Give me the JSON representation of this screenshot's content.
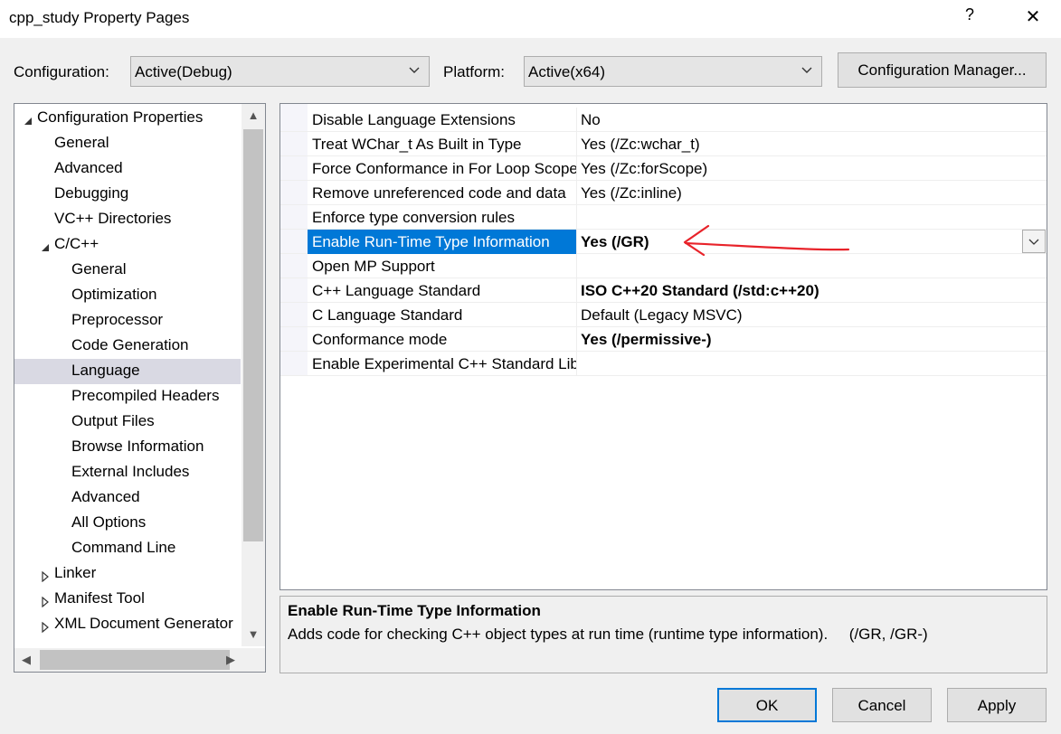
{
  "window": {
    "title": "cpp_study Property Pages",
    "help": "?",
    "close": "✕"
  },
  "config": {
    "config_label": "Configuration:",
    "config_value": "Active(Debug)",
    "platform_label": "Platform:",
    "platform_value": "Active(x64)",
    "manager_button": "Configuration Manager..."
  },
  "tree": {
    "items": [
      {
        "label": "Configuration Properties",
        "expander": "expanded"
      },
      {
        "label": "General"
      },
      {
        "label": "Advanced"
      },
      {
        "label": "Debugging"
      },
      {
        "label": "VC++ Directories"
      },
      {
        "label": "C/C++",
        "expander": "expanded"
      },
      {
        "label": "General"
      },
      {
        "label": "Optimization"
      },
      {
        "label": "Preprocessor"
      },
      {
        "label": "Code Generation"
      },
      {
        "label": "Language",
        "selected": true
      },
      {
        "label": "Precompiled Headers"
      },
      {
        "label": "Output Files"
      },
      {
        "label": "Browse Information"
      },
      {
        "label": "External Includes"
      },
      {
        "label": "Advanced"
      },
      {
        "label": "All Options"
      },
      {
        "label": "Command Line"
      },
      {
        "label": "Linker",
        "expander": "collapsed"
      },
      {
        "label": "Manifest Tool",
        "expander": "collapsed"
      },
      {
        "label": "XML Document Generator",
        "expander": "collapsed"
      }
    ]
  },
  "properties": [
    {
      "name": "Disable Language Extensions",
      "value": "No"
    },
    {
      "name": "Treat WChar_t As Built in Type",
      "value": "Yes (/Zc:wchar_t)"
    },
    {
      "name": "Force Conformance in For Loop Scope",
      "value": "Yes (/Zc:forScope)"
    },
    {
      "name": "Remove unreferenced code and data",
      "value": "Yes (/Zc:inline)"
    },
    {
      "name": "Enforce type conversion rules",
      "value": ""
    },
    {
      "name": "Enable Run-Time Type Information",
      "value": "Yes (/GR)",
      "bold": true,
      "selected": true
    },
    {
      "name": "Open MP Support",
      "value": ""
    },
    {
      "name": "C++ Language Standard",
      "value": "ISO C++20 Standard (/std:c++20)",
      "bold": true
    },
    {
      "name": "C Language Standard",
      "value": "Default (Legacy MSVC)"
    },
    {
      "name": "Conformance mode",
      "value": "Yes (/permissive-)",
      "bold": true
    },
    {
      "name": "Enable Experimental C++ Standard Library Modules",
      "value": ""
    }
  ],
  "description": {
    "title": "Enable Run-Time Type Information",
    "text": "Adds code for checking C++ object types at run time (runtime type information).     (/GR, /GR-)"
  },
  "buttons": {
    "ok": "OK",
    "cancel": "Cancel",
    "apply": "Apply"
  },
  "colors": {
    "selection": "#0078d7",
    "annotation": "#e8232a"
  }
}
